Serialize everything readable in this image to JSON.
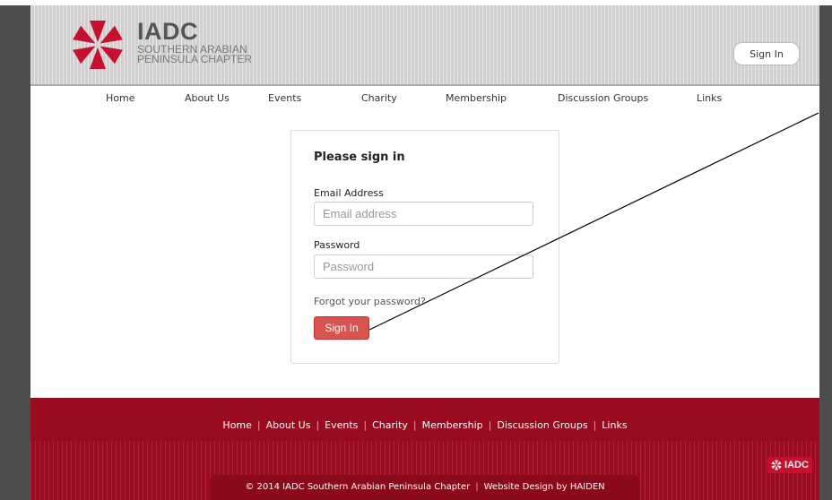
{
  "header": {
    "brand_name": "IADC",
    "brand_sub": "SOUTHERN ARABIAN PENINSULA CHAPTER",
    "signin_label": "Sign In"
  },
  "nav": {
    "items": [
      "Home",
      "About Us",
      "Events",
      "Charity",
      "Membership",
      "Discussion Groups",
      "Links"
    ]
  },
  "signin_panel": {
    "title": "Please sign in",
    "email_label": "Email Address",
    "email_placeholder": "Email address",
    "email_value": "",
    "password_label": "Password",
    "password_placeholder": "Password",
    "password_value": "",
    "forgot_label": "Forgot your password?",
    "submit_label": "Sign In"
  },
  "footer": {
    "links": [
      "Home",
      "About Us",
      "Events",
      "Charity",
      "Membership",
      "Discussion Groups",
      "Links"
    ],
    "separator": "|",
    "badge": "IADC",
    "copyright": "© 2014 IADC Southern Arabian Peninsula Chapter",
    "design_credit": "Website Design by HAIDEN"
  },
  "colors": {
    "brand_red": "#c8102e",
    "footer_red": "#9b0b20",
    "button_red": "#d9534f",
    "header_gray": "#cfcfcf",
    "side_gray": "#4d4d4d"
  },
  "icons": {
    "logo": "iadc-logo-icon",
    "footer_logo": "iadc-mini-logo-icon"
  }
}
